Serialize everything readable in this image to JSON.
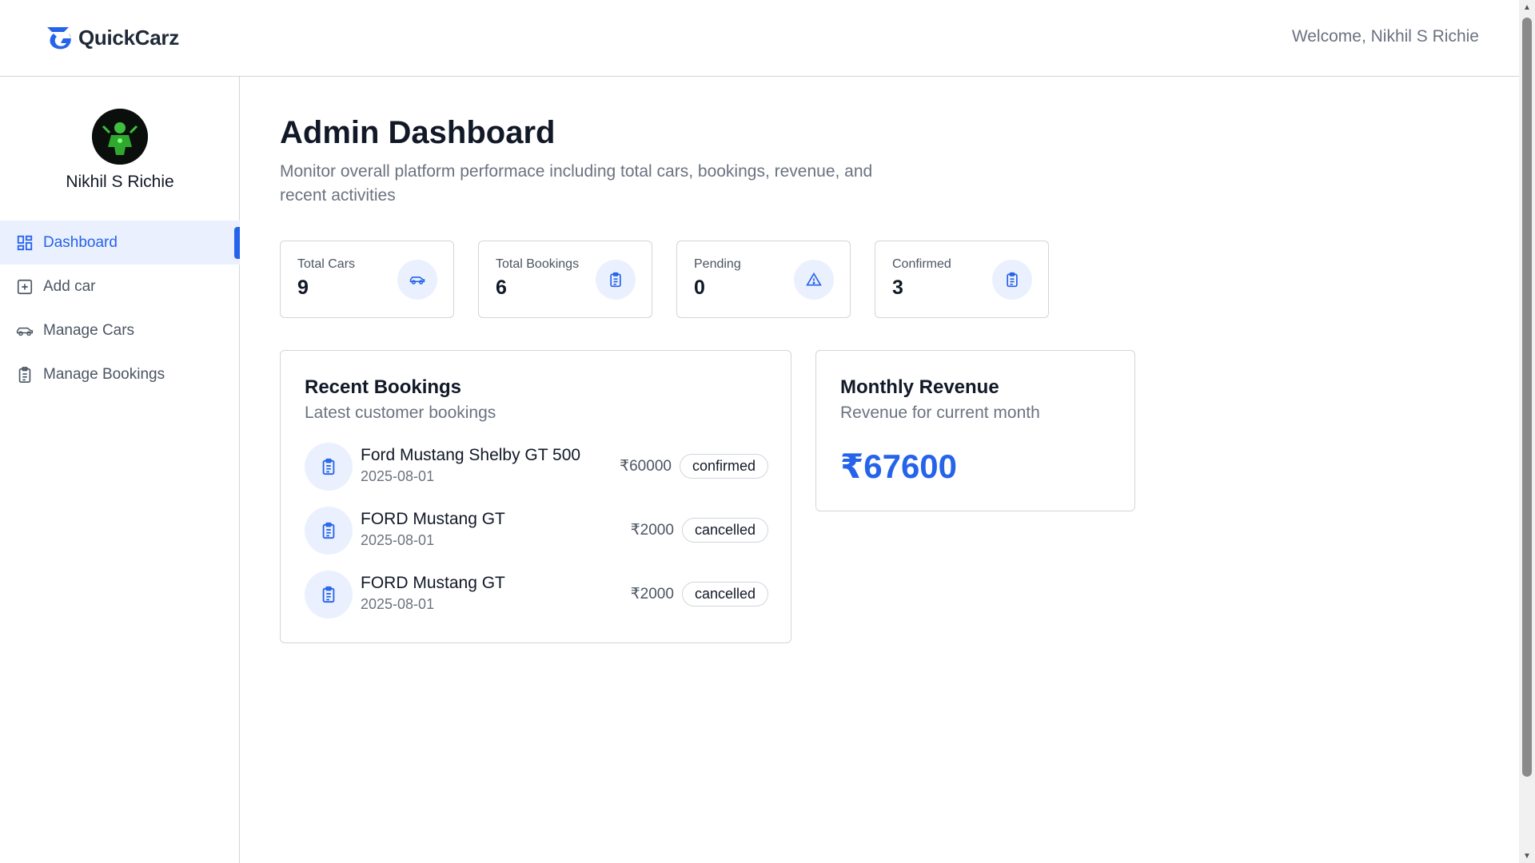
{
  "header": {
    "logo_text": "QuickCarz",
    "welcome": "Welcome, Nikhil S Richie"
  },
  "sidebar": {
    "user_name": "Nikhil S Richie",
    "items": [
      {
        "label": "Dashboard",
        "icon": "dashboard-icon",
        "active": true
      },
      {
        "label": "Add car",
        "icon": "add-square-icon",
        "active": false
      },
      {
        "label": "Manage Cars",
        "icon": "car-icon",
        "active": false
      },
      {
        "label": "Manage Bookings",
        "icon": "clipboard-icon",
        "active": false
      }
    ]
  },
  "main": {
    "title": "Admin Dashboard",
    "subtitle": "Monitor overall platform performace including total cars, bookings, revenue, and recent activities",
    "stats": [
      {
        "label": "Total Cars",
        "value": "9",
        "icon": "car-icon"
      },
      {
        "label": "Total Bookings",
        "value": "6",
        "icon": "clipboard-icon"
      },
      {
        "label": "Pending",
        "value": "0",
        "icon": "warning-icon"
      },
      {
        "label": "Confirmed",
        "value": "3",
        "icon": "clipboard-icon"
      }
    ],
    "recent_bookings": {
      "title": "Recent Bookings",
      "subtitle": "Latest customer bookings",
      "rows": [
        {
          "name": "Ford Mustang Shelby GT 500",
          "date": "2025-08-01",
          "price": "₹60000",
          "status": "confirmed"
        },
        {
          "name": "FORD Mustang GT",
          "date": "2025-08-01",
          "price": "₹2000",
          "status": "cancelled"
        },
        {
          "name": "FORD Mustang GT",
          "date": "2025-08-01",
          "price": "₹2000",
          "status": "cancelled"
        }
      ]
    },
    "monthly_revenue": {
      "title": "Monthly Revenue",
      "subtitle": "Revenue for current month",
      "amount": "₹67600"
    }
  },
  "colors": {
    "accent": "#2563eb",
    "accent_light": "#eaf0fe",
    "border": "#d1d5db",
    "muted_text": "#6b7280"
  }
}
